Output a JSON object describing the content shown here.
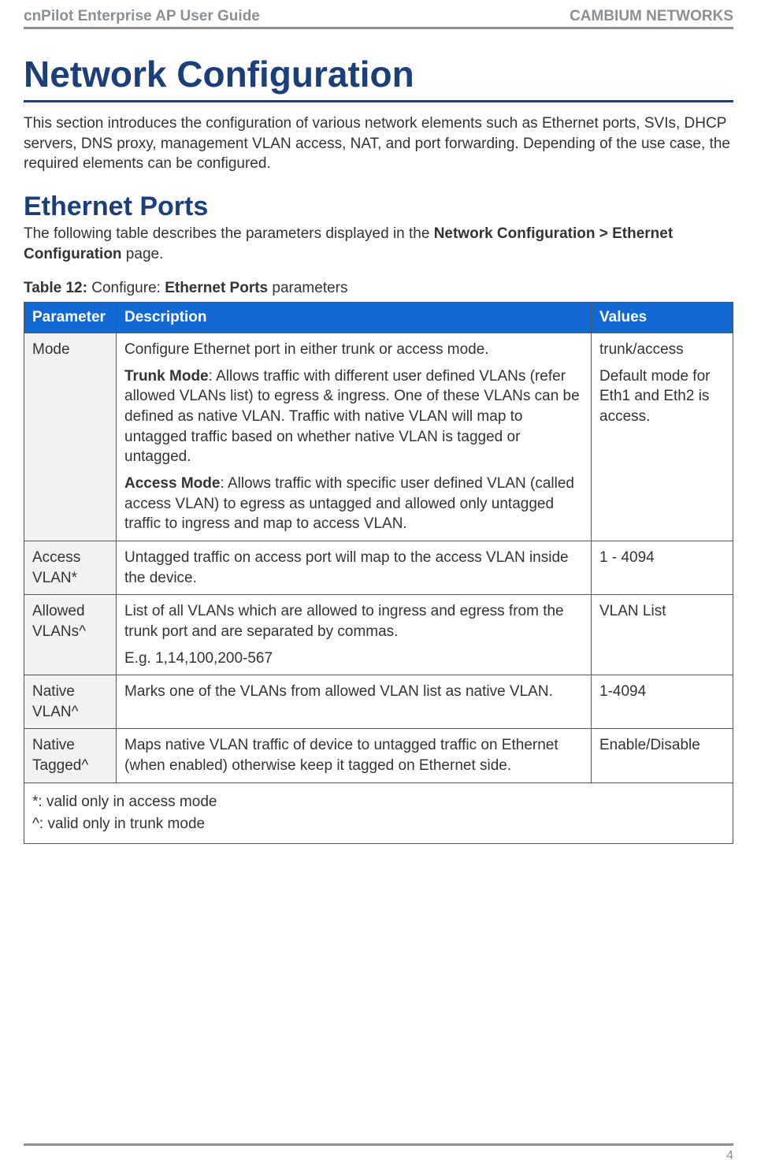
{
  "header": {
    "left": "cnPilot Enterprise AP User Guide",
    "right": "CAMBIUM NETWORKS"
  },
  "h1": "Network Configuration",
  "intro": "This section introduces the configuration of various network elements such as Ethernet ports, SVIs, DHCP servers, DNS proxy, management VLAN access, NAT, and port forwarding. Depending of the use case, the required elements can be configured.",
  "h2": "Ethernet Ports",
  "sub_text_prefix": "The following table describes the parameters displayed in the ",
  "sub_text_bold": "Network Configuration > Ethernet Configuration",
  "sub_text_suffix": " page.",
  "caption_bold1": "Table 12:",
  "caption_mid": " Configure: ",
  "caption_bold2": "Ethernet Ports",
  "caption_suffix": " parameters",
  "table": {
    "headers": {
      "param": "Parameter",
      "desc": "Description",
      "values": "Values"
    },
    "rows": [
      {
        "param": "Mode",
        "desc_p1": "Configure Ethernet port in either trunk or access mode.",
        "desc_p2_bold": "Trunk Mode",
        "desc_p2_rest": ": Allows traffic with different user defined VLANs (refer allowed VLANs list) to egress & ingress. One of these VLANs can be defined as native VLAN. Traffic with native VLAN will map to untagged traffic based on whether native VLAN is tagged or  untagged.",
        "desc_p3_bold": "Access Mode",
        "desc_p3_rest": ": Allows traffic with specific user defined VLAN (called access VLAN) to egress as untagged and allowed only untagged traffic to ingress and map to access VLAN.",
        "values_l1": "trunk/access",
        "values_l2": "Default mode for Eth1 and Eth2 is access."
      },
      {
        "param": "Access VLAN*",
        "desc": "Untagged traffic on access port will map to the access VLAN inside the device.",
        "values": "1 - 4094"
      },
      {
        "param": "Allowed VLANs^",
        "desc_l1": "List of all VLANs which are allowed to ingress and egress from the trunk port and are separated by commas.",
        "desc_l2": "E.g. 1,14,100,200-567",
        "values": "VLAN List"
      },
      {
        "param": "Native VLAN^",
        "desc": "Marks one of the VLANs from allowed VLAN list as native VLAN.",
        "values": "1-4094"
      },
      {
        "param": "Native Tagged^",
        "desc": "Maps native VLAN traffic of device to untagged traffic on Ethernet (when enabled) otherwise keep it tagged on Ethernet side.",
        "values": "Enable/Disable"
      }
    ],
    "footnote1": "*: valid only in access mode",
    "footnote2": "^: valid only in trunk mode"
  },
  "footer": {
    "page": "4"
  }
}
